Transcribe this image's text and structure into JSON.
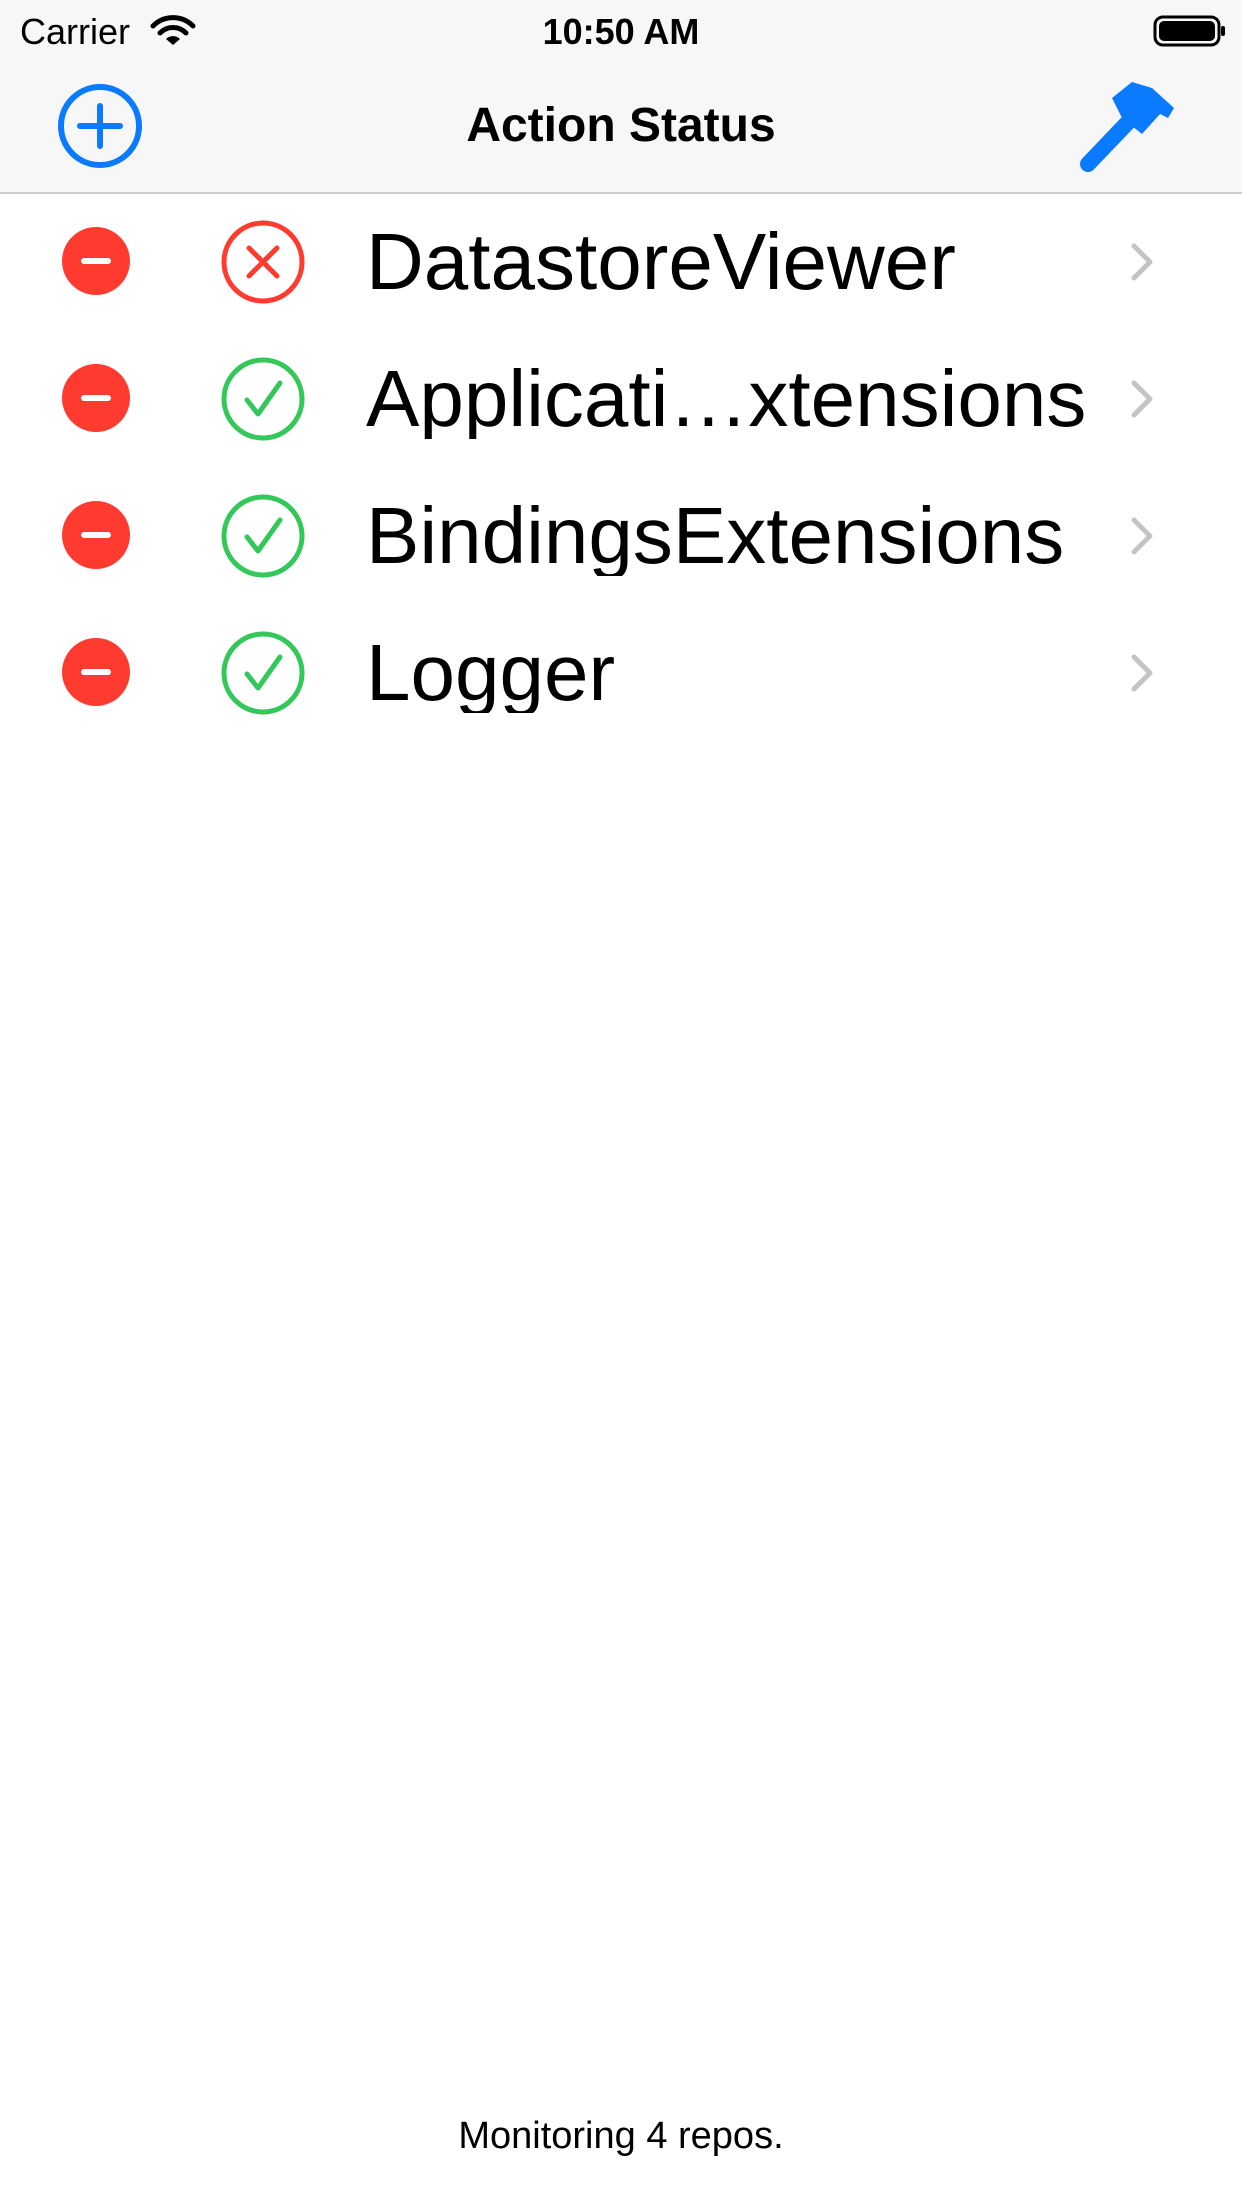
{
  "status_bar": {
    "carrier": "Carrier",
    "time": "10:50 AM"
  },
  "nav": {
    "title": "Action Status",
    "left_icon": "plus-circle-icon",
    "right_icon": "hammer-icon"
  },
  "repos": [
    {
      "name": "DatastoreViewer",
      "status": "failure"
    },
    {
      "name": "Applicati…xtensions",
      "status": "success"
    },
    {
      "name": "BindingsExtensions",
      "status": "success"
    },
    {
      "name": "Logger",
      "status": "success"
    }
  ],
  "footer": {
    "text": "Monitoring 4 repos."
  },
  "colors": {
    "accent": "#0a7aff",
    "delete": "#ff3b30",
    "success": "#34c759",
    "failure": "#ff3b30",
    "chevron": "#c4c4c7",
    "bar_bg": "#f7f7f7"
  }
}
